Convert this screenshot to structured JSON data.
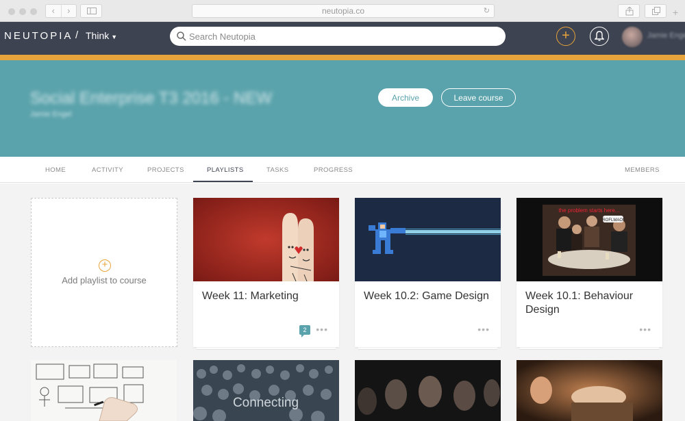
{
  "browser": {
    "url": "neutopia.co"
  },
  "header": {
    "brand": "NEUTOPIA",
    "separator": "/",
    "workspace": "Think",
    "search_placeholder": "Search Neutopia",
    "add_symbol": "+",
    "username": "Jamie Engel"
  },
  "course": {
    "title": "Social Enterprise T3 2016 - NEW",
    "instructor": "Jamie Engel",
    "archive_label": "Archive",
    "leave_label": "Leave course"
  },
  "tabs": [
    {
      "label": "HOME"
    },
    {
      "label": "ACTIVITY"
    },
    {
      "label": "PROJECTS"
    },
    {
      "label": "PLAYLISTS",
      "active": true
    },
    {
      "label": "TASKS"
    },
    {
      "label": "PROGRESS"
    },
    {
      "label": "MEMBERS"
    }
  ],
  "playlists": {
    "add_label": "Add playlist to course",
    "add_symbol": "+",
    "cards": [
      {
        "title": "Week 11: Marketing",
        "comments": "2",
        "more": "•••"
      },
      {
        "title": "Week 10.2: Game Design",
        "more": "•••"
      },
      {
        "title": "Week 10.1: Behaviour Design",
        "more": "•••"
      }
    ],
    "row2": [
      {
        "overlay_text": ""
      },
      {
        "overlay_text": "Connecting"
      },
      {
        "overlay_text": ""
      },
      {
        "overlay_text": ""
      }
    ],
    "thumbnail_texts": {
      "behaviour_caption": "the problem starts here...",
      "behaviour_bubble": "ROFLMAO!"
    }
  },
  "colors": {
    "appbar": "#3d4350",
    "accent_orange": "#e8a43c",
    "banner_teal": "#5ba3ac"
  }
}
